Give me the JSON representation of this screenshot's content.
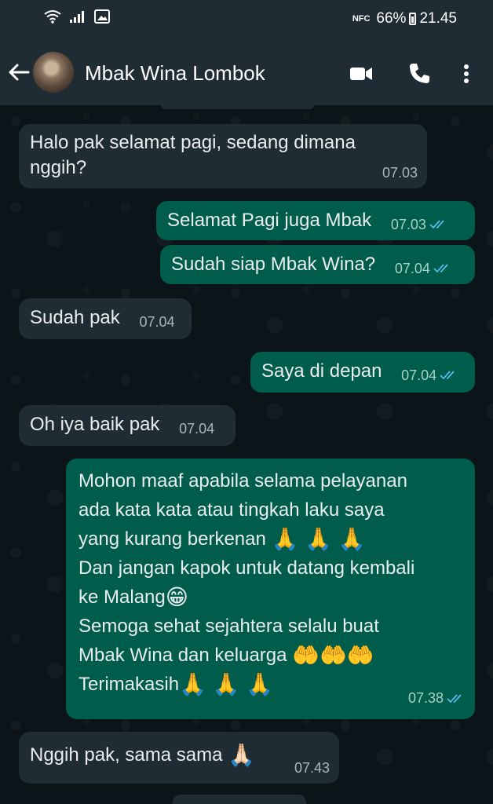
{
  "status_bar": {
    "nfc": "NFC",
    "battery": "66%",
    "time": "21.45"
  },
  "header": {
    "contact_name": "Mbak Wina Lombok"
  },
  "messages": [
    {
      "dir": "in",
      "lines": [
        "Halo pak selamat pagi, sedang dimana",
        "nggih?"
      ],
      "time": "07.03"
    },
    {
      "dir": "out",
      "text": "Selamat Pagi juga Mbak",
      "time": "07.03",
      "read": true
    },
    {
      "dir": "out",
      "text": "Sudah siap Mbak Wina?",
      "time": "07.04",
      "read": true
    },
    {
      "dir": "in",
      "text": "Sudah pak",
      "time": "07.04"
    },
    {
      "dir": "out",
      "text": "Saya di depan",
      "time": "07.04",
      "read": true
    },
    {
      "dir": "in",
      "text": "Oh iya baik pak",
      "time": "07.04"
    },
    {
      "dir": "out",
      "lines": [
        "Mohon maaf apabila selama pelayanan",
        "ada kata kata atau tingkah laku saya",
        "yang kurang berkenan",
        "Dan jangan kapok untuk datang kembali",
        "ke Malang",
        "Semoga sehat sejahtera selalu buat",
        "Mbak Wina dan keluarga",
        "Terimakasih"
      ],
      "emojis": {
        "pray3": "🙏 🙏 🙏",
        "grin": "😁",
        "hands3": "🤲🤲🤲"
      },
      "time": "07.38",
      "read": true
    },
    {
      "dir": "in",
      "text": "Nggih pak, sama sama",
      "emoji": "🙏🏻",
      "time": "07.43"
    }
  ],
  "colors": {
    "incoming": "#1f2c33",
    "outgoing": "#005c4b",
    "read_ticks": "#53bdeb",
    "background": "#0b1418"
  }
}
